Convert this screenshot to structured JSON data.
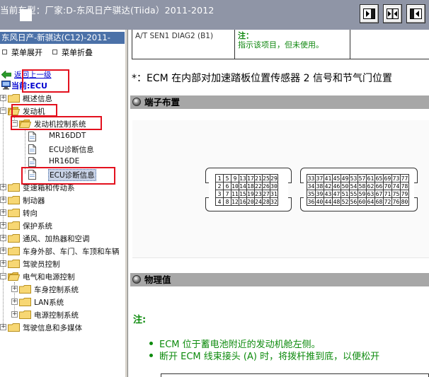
{
  "window": {
    "title": "当前车型：厂家:D-东风日产骐达(Tiida）2011-2012"
  },
  "toolbar": {
    "buttons": [
      "show-panel-icon",
      "split-view-icon",
      "hide-panel-icon"
    ]
  },
  "sidebar": {
    "header": "东风日产-新骐达(C12)-2011-",
    "expand_label": "菜单展开",
    "collapse_label": "菜单折叠",
    "back_label": "返回上一级",
    "current_label": "当前:ECU",
    "tree": [
      {
        "label": "概述信息"
      },
      {
        "label": "发动机"
      },
      {
        "label": "发动机控制系统"
      },
      {
        "label": "MR16DDT"
      },
      {
        "label": "ECU诊断信息"
      },
      {
        "label": "HR16DE"
      },
      {
        "label": "ECU诊断信息"
      },
      {
        "label": "变速箱和传动系"
      },
      {
        "label": "制动器"
      },
      {
        "label": "转向"
      },
      {
        "label": "保护系统"
      },
      {
        "label": "通风、加热器和空调"
      },
      {
        "label": "车身外部、车门、车顶和车辆"
      },
      {
        "label": "驾驶员控制"
      },
      {
        "label": "电气和电源控制"
      },
      {
        "label": "车身控制系统"
      },
      {
        "label": "LAN系统"
      },
      {
        "label": "电源控制系统"
      },
      {
        "label": "驾驶信息和多媒体"
      }
    ]
  },
  "content": {
    "table_row": {
      "col1": "A/T SEN1 DIAG2 (B1)",
      "note_label": "注：",
      "note_text": "指示该项目，但未使用。"
    },
    "ecu_note": "*：ECM 在内部对加速踏板位置传感器 2 信号和节气门位置",
    "section_terminal": "端子布置",
    "connector_left": {
      "rows": [
        [
          "1",
          "5",
          "9",
          "13",
          "17",
          "21",
          "25",
          "29"
        ],
        [
          "2",
          "6",
          "10",
          "14",
          "18",
          "22",
          "26",
          "30"
        ],
        [
          "3",
          "7",
          "11",
          "15",
          "19",
          "23",
          "27",
          "31"
        ],
        [
          "4",
          "8",
          "12",
          "16",
          "20",
          "24",
          "28",
          "32"
        ]
      ]
    },
    "connector_right": {
      "rows": [
        [
          "33",
          "37",
          "41",
          "45",
          "49",
          "53",
          "57",
          "61",
          "65",
          "69",
          "73",
          "77"
        ],
        [
          "34",
          "38",
          "42",
          "46",
          "50",
          "54",
          "58",
          "62",
          "66",
          "70",
          "74",
          "78"
        ],
        [
          "35",
          "39",
          "43",
          "47",
          "51",
          "55",
          "59",
          "63",
          "67",
          "71",
          "75",
          "79"
        ],
        [
          "36",
          "40",
          "44",
          "48",
          "52",
          "56",
          "60",
          "64",
          "68",
          "72",
          "76",
          "80"
        ]
      ]
    },
    "section_physical": "物理值",
    "phys_note_label": "注:",
    "bullets": [
      "ECM 位于蓄电池附近的发动机舱左侧。",
      "断开 ECM 线束接头 (A) 时，将拨杆推到底，以便松开"
    ]
  },
  "colors": {
    "topbar": "#8f95a6",
    "sidebar_header": "#4b71a8",
    "section_header": "#a7a7a7",
    "note_green": "#0d8b0d",
    "highlight_red": "#e3111e",
    "link_blue": "#0000d0"
  }
}
